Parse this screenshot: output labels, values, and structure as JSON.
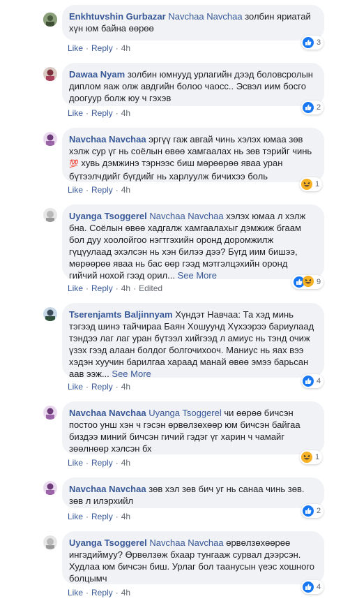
{
  "actions": {
    "like": "Like",
    "reply": "Reply",
    "edited": "Edited"
  },
  "comments": [
    {
      "author": "Enkhtuvshin Gurbazar",
      "mention": "Navchaa Navchaa",
      "text": "золбин яриатай хүн юм байна өөрөө",
      "time": "4h",
      "reactions": "3"
    },
    {
      "author": "Dawaa Nyam",
      "mention": "",
      "text": "золбин юмнууд урлагийн дээд боловсролын диплом яаж олж авдгийн болоо чаосс.. Эсвэл иим босго доогуур болж юу ч гэхэв",
      "time": "4h",
      "reactions": "2"
    },
    {
      "author": "Navchaa Navchaa",
      "mention": "",
      "text1": "эргүү гаж авгай чинь хэлэх юмаа зөв хэлж сур үг нь соёлын өвөө хамгаалах нь зөв тэрийг чинь ",
      "emoji": "💯",
      "text2": " хувь дэмжинэ тэрнээс биш мөрөөрөө яваа уран бүтээлчдийг бүгдийг нь харлуулж бичихээ боль",
      "time": "4h",
      "reactions": "1"
    },
    {
      "author": "Uyanga Tsoggerel",
      "mention": "Navchaa Navchaa",
      "text": "хэлэх юмаа л хэлж бна. Соёлын өвөө хадгалж хамгаалахыг дэмжиж бгаам бол дуу хоолойгоо нэгтгэхийн оронд доромжилж гүцүулаад эхэлсэн нь хэн билээ дээ? Бүгд иим бишээ, мөрөөрөө яваа нь бас өөр гээд мэтгэлцэхийн оронд гийчий нохой гээд орил...",
      "see_more": "See More",
      "time": "4h",
      "reactions": "9"
    },
    {
      "author": "Tserenjamts Baljinnyam",
      "mention": "",
      "text": "Хүндэт Навчаа: Та хэд минь тэгээд шинэ тайчираа Баян Хошуунд Хүхээрээ бариулаад тэндээ лаг лаг уран бүтээл хийгээд л амиус нь тэнд очиж үзэх гээд алаан болдог болгочихооч. Маниус нь яах вээ хэдэн хуучин барилгаа хараад манай өвөө эмээ барьсан аав ээж...",
      "see_more": "See More",
      "time": "4h",
      "reactions": "4"
    },
    {
      "author": "Navchaa Navchaa",
      "mention": "Uyanga Tsoggerel",
      "text": "чи өөрөө бичсэн постоо унш хэн ч гэсэн өрвөлзөхөөр юм бичсэн байгаа биздээ миний бичсэн гичий гэдэг үг харин ч чамайг зөөлнөөр хэлсэн бх",
      "time": "4h",
      "reactions": "1"
    },
    {
      "author": "Navchaa Navchaa",
      "mention": "",
      "text": "зөв хэл зөв бич уг нь санаа чинь зөв. зөв л илэрхийл",
      "time": "4h",
      "reactions": "2"
    },
    {
      "author": "Uyanga Tsoggerel",
      "mention": "Navchaa Navchaa",
      "text": "өрвөлзөхөөрөө ингэдиймуу? Өрвөлзөж бхаар тунгааж сурвал дээрсэн. Худлаа юм бичсэн биш. Урлаг бол таанусын үеэс хошного болцымч",
      "time": "4h",
      "reactions": "4"
    }
  ]
}
